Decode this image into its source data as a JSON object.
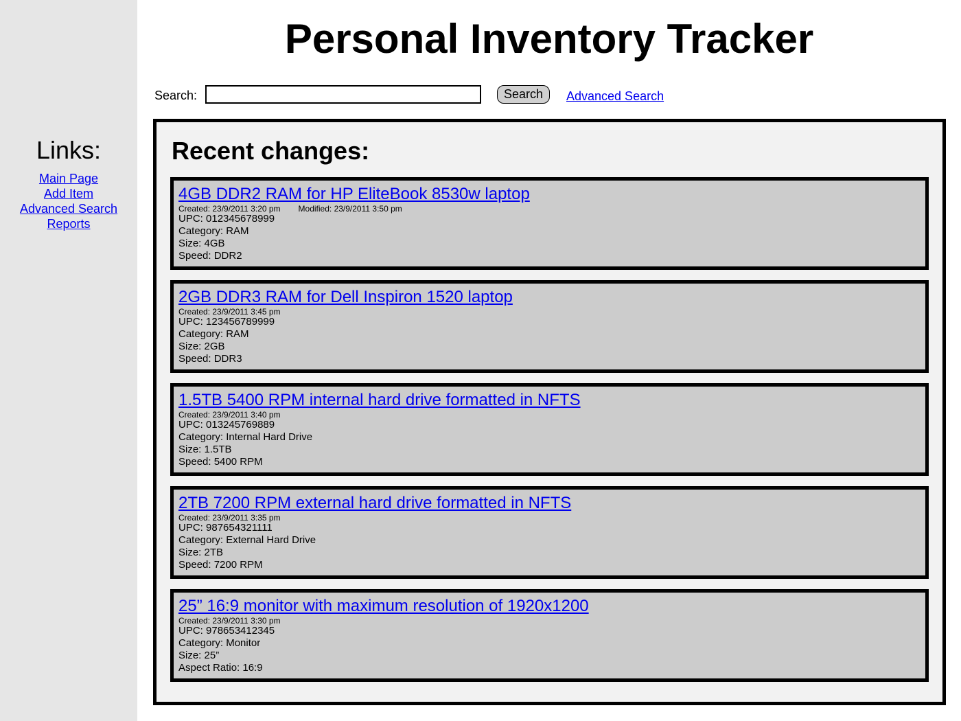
{
  "header": {
    "title": "Personal Inventory Tracker"
  },
  "search": {
    "label": "Search:",
    "value": "",
    "placeholder": "",
    "button_label": "Search",
    "advanced_link": "Advanced Search"
  },
  "sidebar": {
    "heading": "Links:",
    "items": [
      {
        "label": "Main Page"
      },
      {
        "label": "Add Item"
      },
      {
        "label": "Advanced Search"
      },
      {
        "label": "Reports"
      }
    ]
  },
  "recent": {
    "heading": "Recent changes:",
    "items": [
      {
        "title": "4GB DDR2 RAM for HP EliteBook 8530w laptop",
        "created": "Created: 23/9/2011 3:20 pm",
        "modified": "Modified: 23/9/2011 3:50 pm",
        "fields": [
          "UPC: 012345678999",
          "Category: RAM",
          "Size: 4GB",
          "Speed: DDR2"
        ]
      },
      {
        "title": "2GB DDR3 RAM for Dell Inspiron 1520 laptop",
        "created": "Created: 23/9/2011 3:45 pm",
        "modified": "",
        "fields": [
          "UPC: 123456789999",
          "Category: RAM",
          "Size: 2GB",
          "Speed: DDR3"
        ]
      },
      {
        "title": "1.5TB 5400 RPM internal hard drive formatted in NFTS",
        "created": "Created: 23/9/2011 3:40 pm",
        "modified": "",
        "fields": [
          "UPC: 013245769889",
          "Category: Internal Hard Drive",
          "Size: 1.5TB",
          "Speed: 5400 RPM"
        ]
      },
      {
        "title": "2TB 7200 RPM external hard drive formatted in NFTS",
        "created": "Created: 23/9/2011 3:35 pm",
        "modified": "",
        "fields": [
          "UPC: 987654321111",
          "Category: External Hard Drive",
          "Size: 2TB",
          "Speed: 7200 RPM"
        ]
      },
      {
        "title": "25” 16:9 monitor with maximum resolution of 1920x1200",
        "created": "Created: 23/9/2011 3:30 pm",
        "modified": "",
        "fields": [
          "UPC: 978653412345",
          "Category: Monitor",
          "Size: 25”",
          "Aspect Ratio: 16:9"
        ]
      }
    ]
  }
}
